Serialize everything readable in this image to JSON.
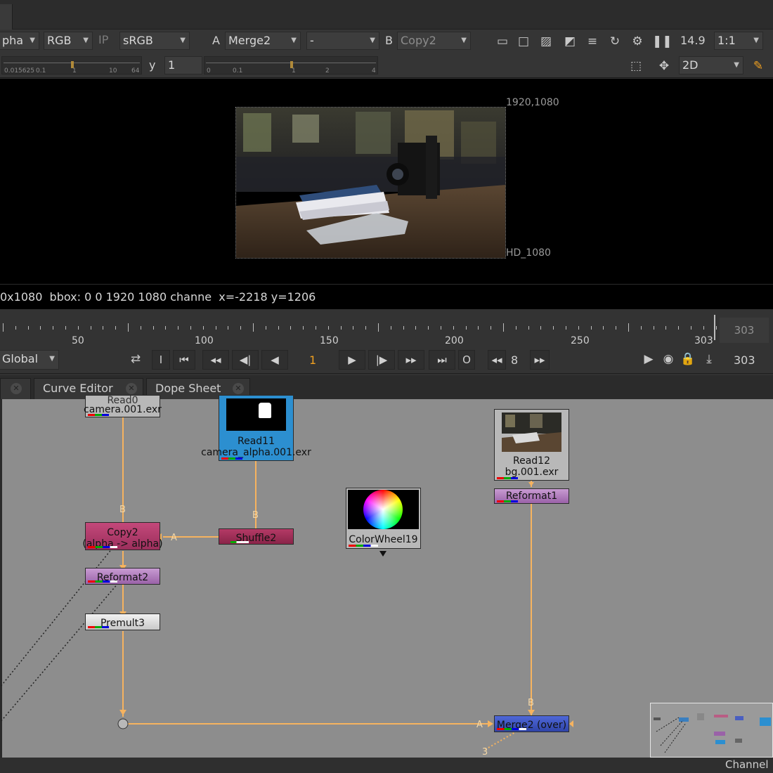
{
  "viewer_toolbar": {
    "channel_set": "pha",
    "display_channels": "RGB",
    "ip_label": "IP",
    "lut": "sRGB",
    "input_a_label": "A",
    "input_a": "Merge2",
    "wipe_op": "-",
    "input_b_label": "B",
    "input_b": "Copy2",
    "zoom_value": "14.9",
    "proxy": "1:1",
    "gain_ticks": [
      "0.015625",
      "0.1",
      "1",
      "10",
      "64"
    ],
    "y_label": "y",
    "gamma_value": "1",
    "gamma_ticks": [
      "0",
      "0.1",
      "1",
      "2",
      "4"
    ],
    "view_mode": "2D"
  },
  "viewer": {
    "top_right_coords": "1920,1080",
    "format_label": "HD_1080",
    "info_line": "0x1080  bbox: 0 0 1920 1080 channe  x=-2218 y=1206"
  },
  "timeline": {
    "tick_labels": [
      "50",
      "100",
      "150",
      "200",
      "250",
      "303"
    ],
    "end_frame": "303",
    "range_mode": "Global",
    "current_frame": "1",
    "step_value": "8",
    "out_frame": "303"
  },
  "panel_tabs": [
    "Curve Editor",
    "Dope Sheet"
  ],
  "nodes": {
    "read_top_partial": "Read0",
    "read_top_file": "camera.001.exr",
    "read11": "Read11",
    "read11_file": "camera_alpha.001.exr",
    "read12": "Read12",
    "read12_file": "bg.001.exr",
    "reformat1": "Reformat1",
    "colorwheel": "ColorWheel19",
    "copy2": "Copy2",
    "copy2_sub": "(alpha -> alpha)",
    "shuffle2": "Shuffle2",
    "reformat2": "Reformat2",
    "premult3": "Premult3",
    "merge2": "Merge2 (over)"
  },
  "pin_labels": {
    "b": "B",
    "a": "A",
    "three": "3"
  },
  "bottom_bar": "Channel",
  "colors": {
    "pipe": "#f6b35f",
    "copy_node": "#b43c6a",
    "shuffle_node": "#9b2b54",
    "reformat_node": "#a46bb0",
    "read11_node": "#2c8fd0",
    "merge_node": "#3d55c7",
    "graph_bg": "#8d8d8d"
  }
}
